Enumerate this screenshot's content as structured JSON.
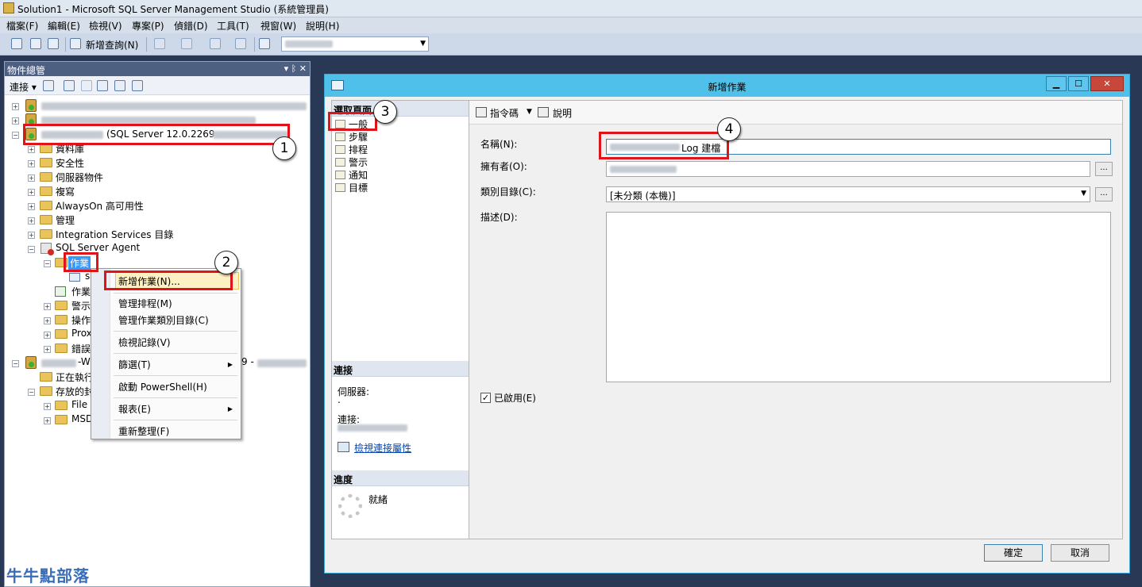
{
  "window": {
    "title": "Solution1 - Microsoft SQL Server Management Studio (系統管理員)"
  },
  "menu": [
    "檔案(F)",
    "編輯(E)",
    "檢視(V)",
    "專案(P)",
    "偵錯(D)",
    "工具(T)",
    "視窗(W)",
    "說明(H)"
  ],
  "toolbar": {
    "new_query": "新增查詢(N)"
  },
  "object_explorer": {
    "title": "物件總管",
    "pin": "▾ ᛒ ✕",
    "connect": "連接 ▾",
    "server_label": "(SQL Server 12.0.2269 -",
    "nodes": {
      "databases": "資料庫",
      "security": "安全性",
      "server_objects": "伺服器物件",
      "replication": "複寫",
      "alwayson": "AlwaysOn 高可用性",
      "management": "管理",
      "integration": "Integration Services 目錄",
      "agent": "SQL Server Agent",
      "jobs": "作業",
      "job_child": "s",
      "job_activity": "作業",
      "alerts": "警示",
      "operators": "操作",
      "proxies": "Prox",
      "errorlogs": "錯誤",
      "server2_prefix": "-W",
      "server2_suffix": "9 -",
      "running": "正在執行",
      "stored": "存放的封",
      "file": "File S",
      "msdb": "MSD"
    }
  },
  "context_menu": {
    "items": [
      {
        "label": "新增作業(N)...",
        "submenu": false
      },
      {
        "label": "管理排程(M)",
        "submenu": false
      },
      {
        "label": "管理作業類別目錄(C)",
        "submenu": false
      },
      {
        "label": "檢視記錄(V)",
        "submenu": false
      },
      {
        "label": "篩選(T)",
        "submenu": true
      },
      {
        "label": "啟動 PowerShell(H)",
        "submenu": false
      },
      {
        "label": "報表(E)",
        "submenu": true
      },
      {
        "label": "重新整理(F)",
        "submenu": false
      }
    ],
    "submenu_arrow": "▶"
  },
  "dialog": {
    "title": "新增作業",
    "select_page": "選取頁面",
    "pages": [
      "一般",
      "步驟",
      "排程",
      "警示",
      "通知",
      "目標"
    ],
    "connection_head": "連接",
    "server_label": "伺服器:",
    "server_value": ".",
    "connection_label": "連接:",
    "view_conn_props": "檢視連接屬性",
    "progress_head": "進度",
    "progress_status": "就緒",
    "script_btn": "指令碼",
    "help_btn": "說明",
    "name_label": "名稱(N):",
    "name_value_suffix": "Log 建檔",
    "owner_label": "擁有者(O):",
    "category_label": "類別目錄(C):",
    "category_value": "[未分類 (本機)]",
    "desc_label": "描述(D):",
    "enabled_label": "已啟用(E)",
    "enabled": true,
    "ok": "確定",
    "cancel": "取消",
    "dots": "...",
    "min": "▁",
    "max": "☐",
    "close": "✕"
  },
  "callouts": [
    "1",
    "2",
    "3",
    "4"
  ],
  "watermark": "牛牛點部落",
  "colors": {
    "highlight": "#fdf0c2",
    "annotation_red": "#e0121a",
    "dialog_title": "#4fc0ea"
  }
}
